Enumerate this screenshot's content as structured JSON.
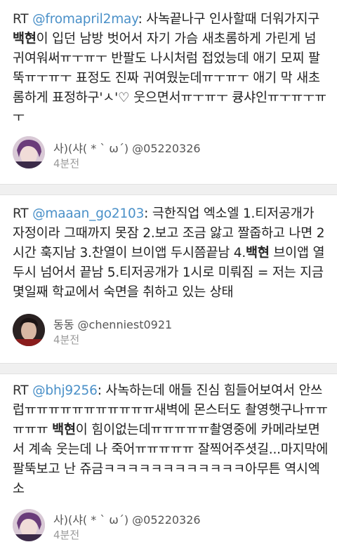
{
  "tweets": [
    {
      "rt": "RT",
      "mention": "@fromapril2may",
      "text_before": ": 사녹끝나구 인사할때 더워가지구 ",
      "keyword": "백현",
      "text_after": "이 입던 남방 벗어서 자기 가슴 새초롬하게 가린게 넘 귀여워써ㅠㅜㅠㅜ 반팔도 나시처럼 접었능데 애기 모찌 팔뚝ㅠㅜㅠㅜ 표정도 진짜 귀여웠눈데ㅠㅜㅠㅜ 애기 막 새초롬하게 표정하구'ㅅ'♡ 웃으면서ㅠㅜㅠㅜ 큥샤인ㅠㅜㅠㅜㅠㅜ",
      "author": "사)(샤( * ` ω´) @05220326",
      "time": "4분전"
    },
    {
      "rt": "RT",
      "mention": "@maaan_go2103",
      "text_before": ": 극한직업 엑소엘 1.티저공개가 자정이라 그때까지 못잠 2.보고 조금 앓고 짤줍하고 나면 2시간 훅지남 3.찬열이 브이앱 두시쯤끝남 4.",
      "keyword": "백현",
      "text_after": " 브이앱 열두시 넘어서 끝남 5.티저공개가 1시로 미뤄짐 = 저는 지금 몇일째 학교에서 숙면을 취하고 있는 상태",
      "author": "동동 @chenniest0921",
      "time": "4분전"
    },
    {
      "rt": "RT",
      "mention": "@bhj9256",
      "text_before": ": 사녹하는데 애들 진심 힘들어보여서 안쓰럽ㅠㅠㅠㅠㅠㅠㅠㅠㅠㅠㅠ새벽에 몬스터도 촬영햇구나ㅠㅠㅠㅠㅠ ",
      "keyword": "백현",
      "text_after": "이 힘이없는데ㅠㅠㅠㅠㅠ촬영중에 카메라보면서 계속 웃는데 나 죽어ㅠㅠㅠㅠㅠ 잘찍어주셧길...마지막에 팔뚝보고 난 쥬금ㅋㅋㅋㅋㅋㅋㅋㅋㅋㅋㅋㅋ아무튼 역시엑소",
      "author": "사)(샤( * ` ω´) @05220326",
      "time": "4분전"
    }
  ]
}
